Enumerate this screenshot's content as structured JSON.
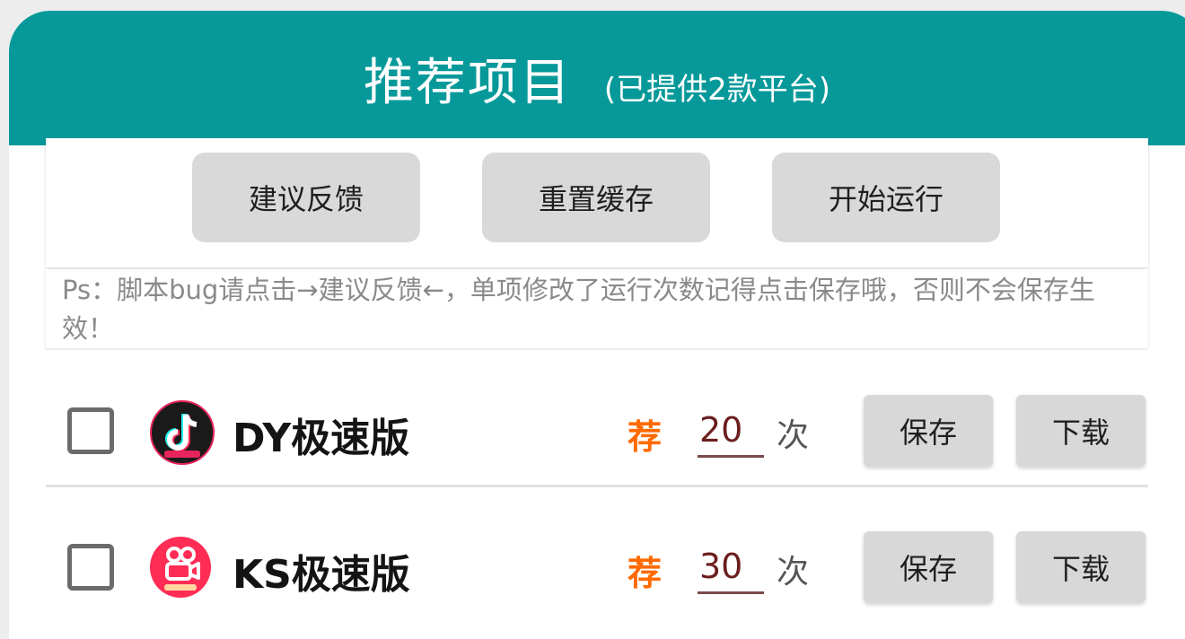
{
  "header": {
    "title": "推荐项目",
    "subtitle": "(已提供2款平台)",
    "color": "#07999a"
  },
  "actions": {
    "feedback_label": "建议反馈",
    "reset_cache_label": "重置缓存",
    "start_label": "开始运行"
  },
  "tip": {
    "text": "Ps：脚本bug请点击→建议反馈←，单项修改了运行次数记得点击保存哦，否则不会保存生效！"
  },
  "apps": [
    {
      "name": "DY极速版",
      "icon": "douyin-icon",
      "checked": false,
      "rec_label": "荐",
      "count": "20",
      "unit": "次",
      "save_label": "保存",
      "download_label": "下载"
    },
    {
      "name": "KS极速版",
      "icon": "kuaishou-icon",
      "checked": false,
      "rec_label": "荐",
      "count": "30",
      "unit": "次",
      "save_label": "保存",
      "download_label": "下载"
    }
  ]
}
